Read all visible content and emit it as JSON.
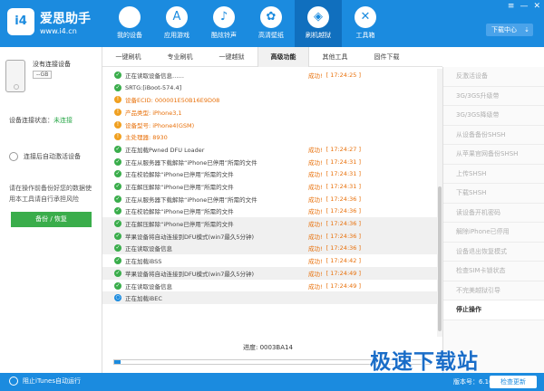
{
  "header": {
    "brand": "爱思助手",
    "url": "www.i4.cn",
    "logo_text": "i4",
    "nav": [
      {
        "label": "我的设备",
        "icon": "apple-icon",
        "glyph": ""
      },
      {
        "label": "应用游戏",
        "icon": "app-store-icon",
        "glyph": "A"
      },
      {
        "label": "酷炫铃声",
        "icon": "bell-icon",
        "glyph": "♪"
      },
      {
        "label": "高清壁纸",
        "icon": "wallpaper-icon",
        "glyph": "✿"
      },
      {
        "label": "刷机越狱",
        "icon": "dropbox-icon",
        "glyph": "◈"
      },
      {
        "label": "工具箱",
        "icon": "tools-icon",
        "glyph": "✕"
      }
    ],
    "download_label": "下载中心",
    "download_arrow": "⇣",
    "window_buttons": [
      "≡",
      "—",
      "✕"
    ]
  },
  "device": {
    "name": "没有连接设备",
    "capacity": "--GB",
    "status_label": "设备连接状态：",
    "status_value": "未连接",
    "auto_activate_label": "连接后自动激活设备",
    "backup_tip": "请在操作前备份好您的数据使用本工具请自行承担风险",
    "backup_button": "备份 / 恢复"
  },
  "tabs": [
    "一键刷机",
    "专业刷机",
    "一键越狱",
    "高级功能",
    "其他工具",
    "固件下载"
  ],
  "active_tab": "高级功能",
  "log": [
    {
      "type": "ok",
      "text": "正在读取设备信息……",
      "result": "成功!",
      "time": "[ 17:24:25 ]"
    },
    {
      "type": "ok",
      "text": "SRTG:[iBoot-574.4]",
      "result": "",
      "time": ""
    },
    {
      "type": "info",
      "text": "设备ECID: 000001E50B16E9D08",
      "result": "",
      "time": ""
    },
    {
      "type": "info",
      "text": "产品类型: iPhone3,1",
      "result": "",
      "time": ""
    },
    {
      "type": "info",
      "text": "设备型号: iPhone4(GSM)",
      "result": "",
      "time": ""
    },
    {
      "type": "info",
      "text": "主处理器: 8930",
      "result": "",
      "time": ""
    },
    {
      "type": "ok",
      "text": "正在加载Pwned DFU Loader",
      "result": "成功!",
      "time": "[ 17:24:27 ]"
    },
    {
      "type": "ok",
      "text": "正在从服务器下载解除“iPhone已停用”所需的文件",
      "result": "成功!",
      "time": "[ 17:24:31 ]"
    },
    {
      "type": "ok",
      "text": "正在校验解除“iPhone已停用”所需的文件",
      "result": "成功!",
      "time": "[ 17:24:31 ]"
    },
    {
      "type": "ok",
      "text": "正在解压解除“iPhone已停用”所需的文件",
      "result": "成功!",
      "time": "[ 17:24:31 ]"
    },
    {
      "type": "ok",
      "text": "正在从服务器下载解除“iPhone已停用”所需的文件",
      "result": "成功!",
      "time": "[ 17:24:36 ]"
    },
    {
      "type": "ok",
      "text": "正在校验解除“iPhone已停用”所需的文件",
      "result": "成功!",
      "time": "[ 17:24:36 ]"
    },
    {
      "type": "ok",
      "text": "正在解压解除“iPhone已停用”所需的文件",
      "result": "成功!",
      "time": "[ 17:24:36 ]"
    },
    {
      "type": "ok",
      "text": "苹果设备将自动连接到DFU模式(win7最久5分钟)",
      "result": "成功!",
      "time": "[ 17:24:36 ]"
    },
    {
      "type": "ok",
      "text": "正在读取设备信息",
      "result": "成功!",
      "time": "[ 17:24:36 ]"
    },
    {
      "type": "ok",
      "text": "正在加载iBSS",
      "result": "成功!",
      "time": "[ 17:24:42 ]"
    },
    {
      "type": "ok",
      "text": "苹果设备将自动连接到DFU模式(win7最久5分钟)",
      "result": "成功!",
      "time": "[ 17:24:49 ]"
    },
    {
      "type": "ok",
      "text": "正在读取设备信息",
      "result": "成功!",
      "time": "[ 17:24:49 ]"
    },
    {
      "type": "run",
      "text": "正在加载iBEC",
      "result": "",
      "time": ""
    }
  ],
  "progress": {
    "label": "进度: 0003BA14",
    "fraction": 0.02
  },
  "sidebar": [
    "反激活设备",
    "3G/3GS升级带",
    "3G/3GS降级带",
    "从设备备份SHSH",
    "从苹果官网备份SHSH",
    "上传SHSH",
    "下载SHSH",
    "读设备开机密码",
    "解除iPhone已停用",
    "设备退出恢复模式",
    "检查SIM卡锁状态",
    "不完美越狱引导",
    "停止操作"
  ],
  "sidebar_active": "停止操作",
  "footer": {
    "itunes_label": "阻止iTunes自动运行",
    "version": "版本号：6.16",
    "update_button": "检查更新"
  },
  "watermark": "极速下载站",
  "colors": {
    "primary": "#1b8bdf",
    "success": "#3aad4b",
    "warning": "#e8700a"
  }
}
